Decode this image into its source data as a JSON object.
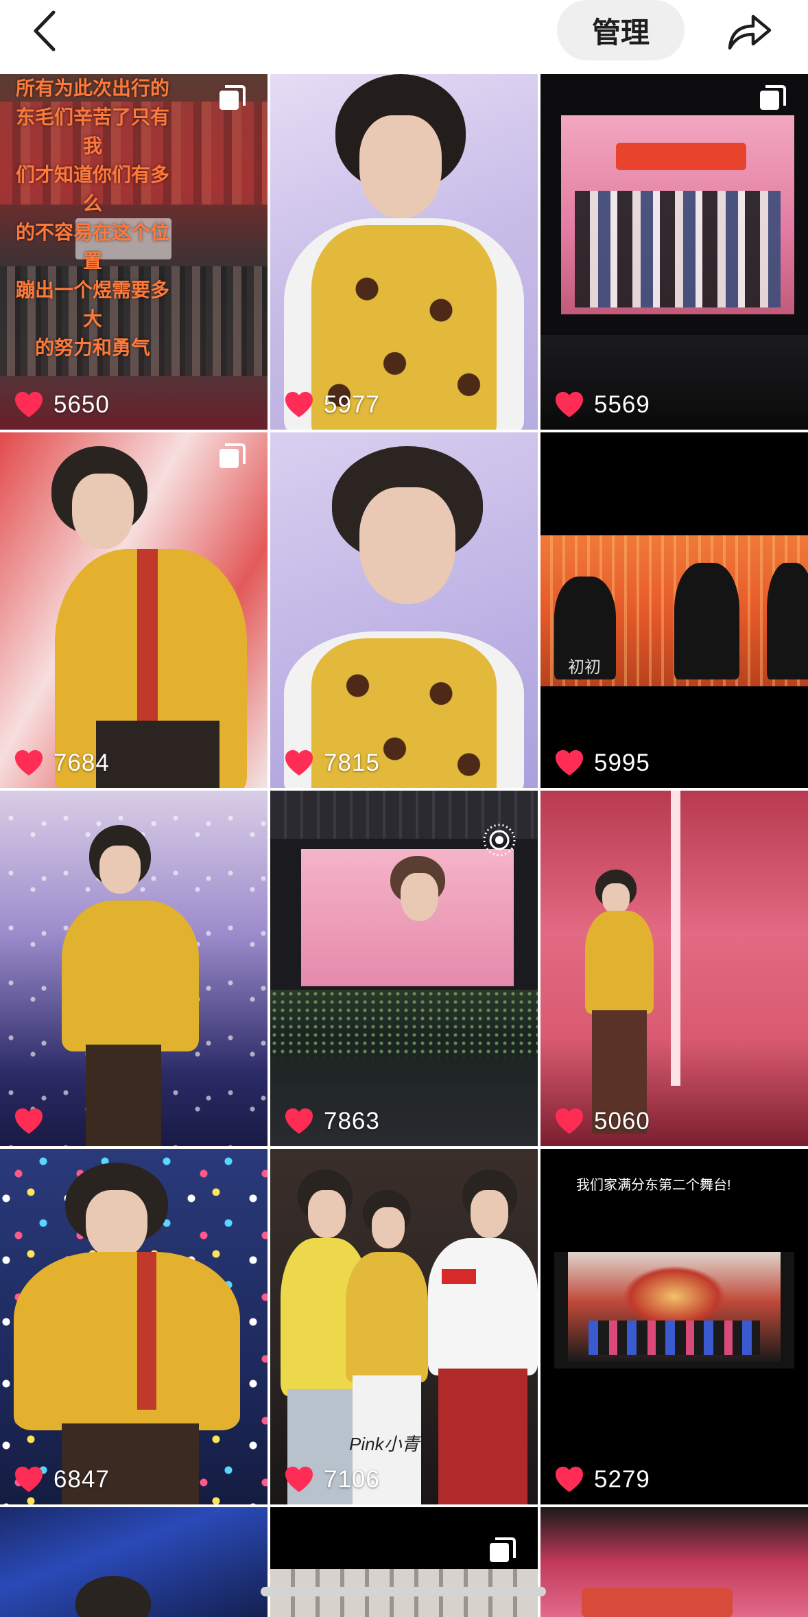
{
  "header": {
    "back_icon": "chevron-left-icon",
    "manage_label": "管理",
    "share_icon": "share-arrow-icon"
  },
  "tiles": [
    {
      "likes": "5650",
      "overlay_text": "所有为此次出行的\n东毛们辛苦了只有我\n们才知道你们有多么\n的不容易在这个位置\n蹦出一个煜需要多大\n的努力和勇气",
      "badge": "multi-photo-icon"
    },
    {
      "likes": "5977"
    },
    {
      "likes": "5569",
      "badge": "multi-photo-icon"
    },
    {
      "likes": "7684",
      "badge": "multi-photo-icon"
    },
    {
      "likes": "7815"
    },
    {
      "likes": "5995",
      "watermark": "初初"
    },
    {
      "likes": ""
    },
    {
      "likes": "7863",
      "badge": "live-photo-icon"
    },
    {
      "likes": "5060"
    },
    {
      "likes": "6847"
    },
    {
      "likes": "7106",
      "watermark": "Pink小青"
    },
    {
      "likes": "5279",
      "caption": "我们家满分东第二个舞台!"
    },
    {
      "likes": ""
    },
    {
      "likes": "",
      "badge": "multi-photo-icon"
    },
    {
      "likes": ""
    }
  ],
  "colors": {
    "heart": "#ff2d55",
    "manage_bg": "#efefef"
  }
}
